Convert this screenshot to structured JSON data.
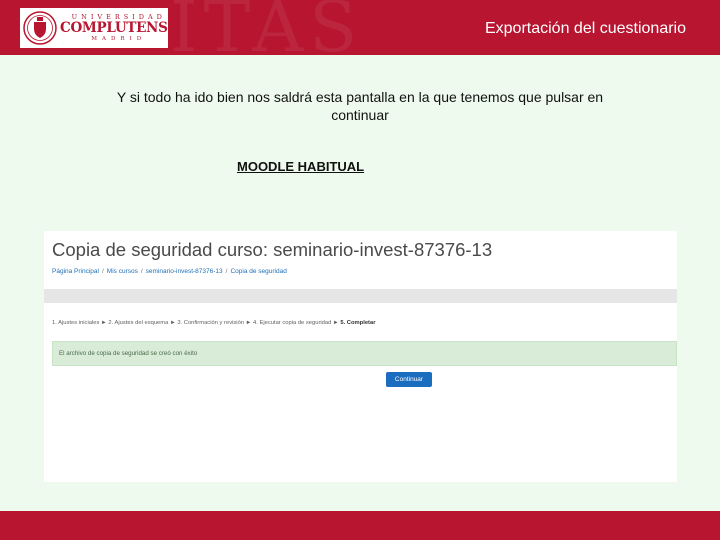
{
  "header": {
    "title": "Exportación del cuestionario",
    "background_text": "ITAS",
    "logo": {
      "top": "UNIVERSIDAD",
      "main": "COMPLUTENSE",
      "bottom": "MADRID"
    }
  },
  "intro": {
    "text": "Y si todo ha ido bien nos saldrá esta pantalla en la que tenemos que pulsar en",
    "emphasis": "continuar"
  },
  "section_label": "MOODLE HABITUAL",
  "screenshot": {
    "title": "Copia de seguridad curso: seminario-invest-87376-13",
    "breadcrumb": [
      "Página Principal",
      "Mis cursos",
      "seminario-invest-87376-13",
      "Copia de seguridad"
    ],
    "breadcrumb_separator": "/",
    "steps": [
      "1. Ajustes iniciales",
      "2. Ajustes del esquema",
      "3. Confirmación y revisión",
      "4. Ejecutar copia de seguridad",
      "5. Completar"
    ],
    "step_separator": "►",
    "alert": "El archivo de copia de seguridad se creó con éxito",
    "continue_label": "Continuar"
  },
  "colors": {
    "brand": "#b71530",
    "page_background": "#eefaee",
    "alert_background": "#d9ecd8",
    "button": "#1b6dbf"
  }
}
